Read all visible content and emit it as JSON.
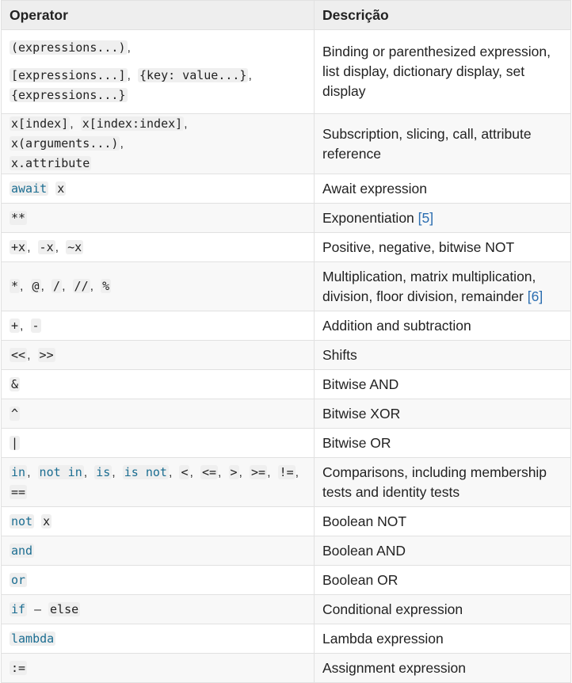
{
  "header": {
    "operator": "Operator",
    "description": "Descrição"
  },
  "rows": [
    {
      "desc": "Binding or parenthesized expression, list display, dictionary display, set display"
    },
    {
      "desc": "Subscription, slicing, call, attribute reference"
    },
    {
      "desc": "Await expression"
    },
    {
      "desc": "Exponentiation",
      "ref": "[5]"
    },
    {
      "desc": "Positive, negative, bitwise NOT"
    },
    {
      "desc": "Multiplication, matrix multiplication, division, floor division, remainder",
      "ref": "[6]"
    },
    {
      "desc": "Addition and subtraction"
    },
    {
      "desc": "Shifts"
    },
    {
      "desc": "Bitwise AND"
    },
    {
      "desc": "Bitwise XOR"
    },
    {
      "desc": "Bitwise OR"
    },
    {
      "desc": "Comparisons, including membership tests and identity tests"
    },
    {
      "desc": "Boolean NOT"
    },
    {
      "desc": "Boolean AND"
    },
    {
      "desc": "Boolean OR"
    },
    {
      "desc": "Conditional expression"
    },
    {
      "desc": "Lambda expression"
    },
    {
      "desc": "Assignment expression"
    }
  ],
  "ops": {
    "r0": {
      "a": "(expressions...)",
      "b": "[expressions...]",
      "c": "{key: value...}",
      "d": "{expressions...}",
      "comma": ","
    },
    "r1": {
      "a": "x[index]",
      "b": "x[index:index]",
      "c": "x(arguments...)",
      "d": "x.attribute",
      "comma": ","
    },
    "r2": {
      "kw": "await",
      "x": "x"
    },
    "r3": {
      "a": "**"
    },
    "r4": {
      "a": "+x",
      "b": "-x",
      "c": "~x"
    },
    "r5": {
      "a": "*",
      "b": "@",
      "c": "/",
      "d": "//",
      "e": "%"
    },
    "r6": {
      "a": "+",
      "b": "-"
    },
    "r7": {
      "a": "<<",
      "b": ">>"
    },
    "r8": {
      "a": "&"
    },
    "r9": {
      "a": "^"
    },
    "r10": {
      "a": "|"
    },
    "r11": {
      "in": "in",
      "notin": "not in",
      "is": "is",
      "isnot": "is not",
      "lt": "<",
      "le": "<=",
      "gt": ">",
      "ge": ">=",
      "ne": "!=",
      "eq": "=="
    },
    "r12": {
      "kw": "not",
      "x": "x"
    },
    "r13": {
      "kw": "and"
    },
    "r14": {
      "kw": "or"
    },
    "r15": {
      "kw": "if",
      "dash": "–",
      "else": "else"
    },
    "r16": {
      "kw": "lambda"
    },
    "r17": {
      "a": ":="
    }
  },
  "colors": {
    "keyword": "#1b6d91",
    "link": "#2a6db0",
    "header_bg": "#eeeeee",
    "row_alt_bg": "#f8f8f8",
    "code_bg": "#efefef",
    "border": "#e1e1e1"
  }
}
